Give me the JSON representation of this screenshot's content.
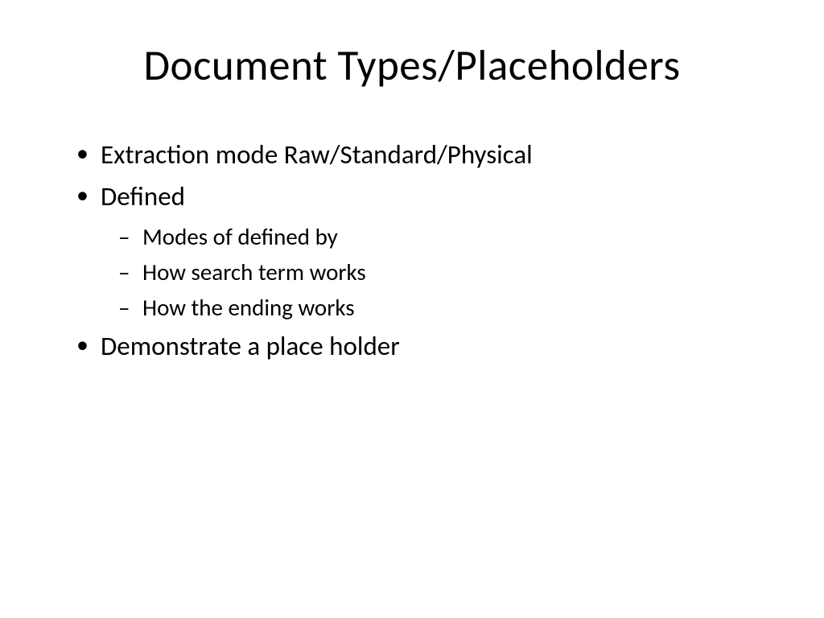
{
  "slide": {
    "title": "Document Types/Placeholders",
    "bullets": {
      "item1": "Extraction mode Raw/Standard/Physical",
      "item2": "Defined",
      "item2_sub1": "Modes of defined by",
      "item2_sub2": "How search term works",
      "item2_sub3": "How the ending works",
      "item3": "Demonstrate a place holder"
    }
  }
}
